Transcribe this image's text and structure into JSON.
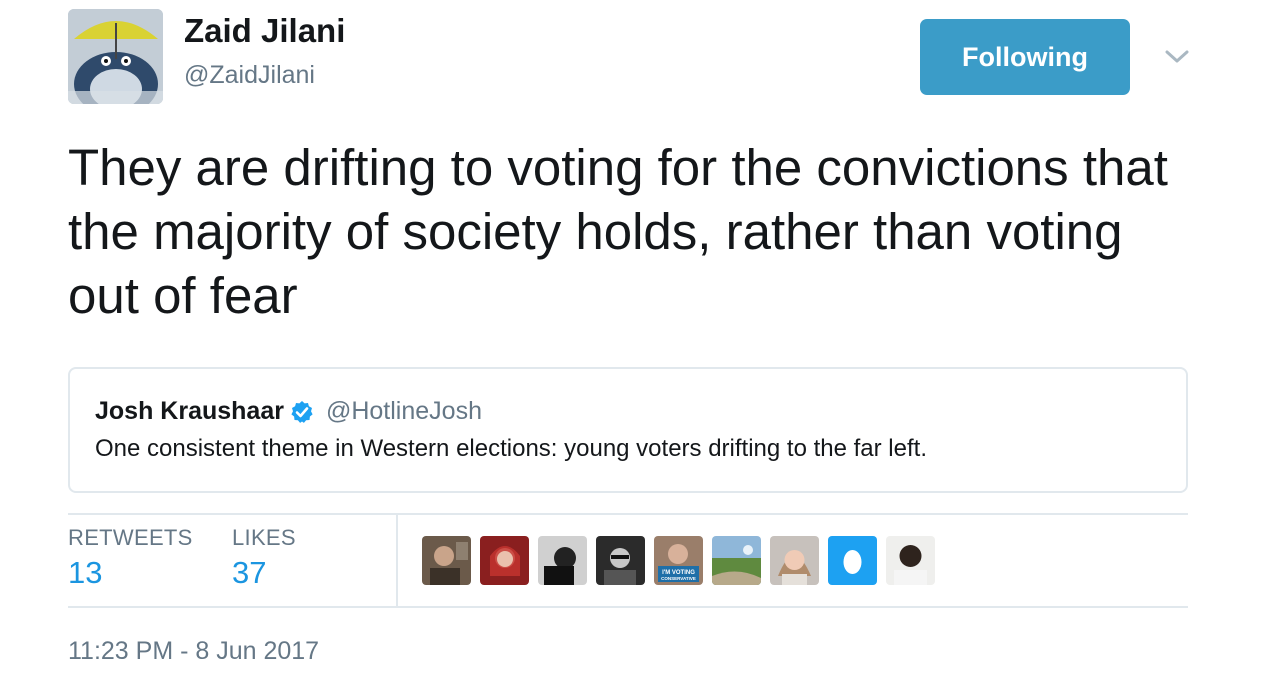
{
  "author": {
    "name": "Zaid Jilani",
    "handle": "@ZaidJilani",
    "avatar_icon": "totoro-umbrella-avatar"
  },
  "follow_button": {
    "label": "Following",
    "color": "#3b9cc8"
  },
  "menu_icon": "chevron-down-icon",
  "tweet": {
    "text": "They are drifting to voting for the convictions that the majority of society holds, rather than voting out of fear"
  },
  "quoted_tweet": {
    "name": "Josh Kraushaar",
    "verified": true,
    "handle": "@HotlineJosh",
    "text": "One consistent theme in Western elections: young voters drifting to the far left."
  },
  "stats": {
    "retweets_label": "RETWEETS",
    "retweets_count": "13",
    "likes_label": "LIKES",
    "likes_count": "37"
  },
  "likers": [
    "liker-avatar-1",
    "liker-avatar-2",
    "liker-avatar-3",
    "liker-avatar-4",
    "liker-avatar-5",
    "liker-avatar-6",
    "liker-avatar-7",
    "liker-avatar-8-default-egg",
    "liker-avatar-9"
  ],
  "liker_badge_text": "I'M VOTING CONSERVATIVE",
  "timestamp": "11:23 PM - 8 Jun 2017",
  "colors": {
    "link_blue": "#1b95e0",
    "muted_gray": "#657786",
    "text_dark": "#14171a",
    "border": "#e1e8ed"
  }
}
